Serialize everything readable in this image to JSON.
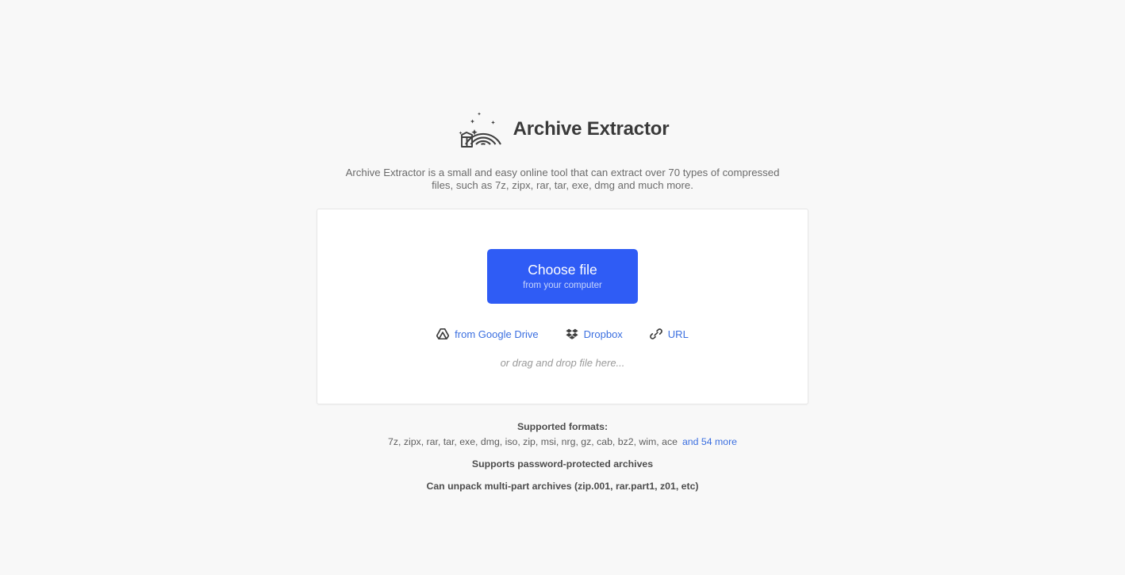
{
  "header": {
    "logo_icon": "rainbow-box-icon",
    "title": "Archive Extractor",
    "description": "Archive Extractor is a small and easy online tool that can extract over 70 types of compressed files, such as 7z, zipx, rar, tar, exe, dmg and much more."
  },
  "uploader": {
    "choose_file_label": "Choose file",
    "choose_file_sub": "from your computer",
    "drop_hint": "or drag and drop file here...",
    "services": [
      {
        "label": "from Google Drive",
        "icon": "google-drive-icon"
      },
      {
        "label": "Dropbox",
        "icon": "dropbox-icon"
      },
      {
        "label": "URL",
        "icon": "link-icon"
      }
    ]
  },
  "footer": {
    "supported_formats_title": "Supported formats:",
    "formats_list": "7z, zipx, rar, tar, exe, dmg, iso, zip, msi, nrg, gz, cab, bz2, wim, ace",
    "more_link": "and 54 more",
    "password_line": "Supports password-protected archives",
    "multipart_line": "Can unpack multi-part archives (zip.001, rar.part1, z01, etc)"
  },
  "colors": {
    "page_background": "#f8f8f8",
    "card_background": "#ffffff",
    "card_border": "#e6e6e6",
    "primary_button": "#2f5cf5",
    "link": "#3b6fe0",
    "title_text": "#3a3a3a",
    "body_text": "#6b6b6b",
    "hint_text": "#9a9a9a",
    "icon_gray": "#3f3f3f"
  }
}
